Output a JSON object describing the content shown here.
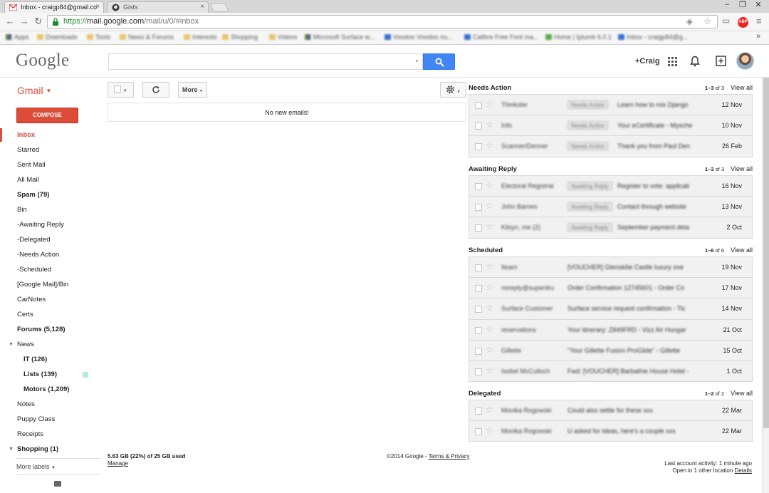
{
  "browser": {
    "tabs": [
      {
        "title": "Inbox - craigp84@gmail.co",
        "active": true,
        "icon": "gmail-icon"
      },
      {
        "title": "Gists",
        "active": false,
        "icon": "github-icon"
      }
    ],
    "url": {
      "scheme": "https://",
      "host": "mail.google.com",
      "path": "/mail/u/0/#inbox"
    },
    "abp_label": "ABP",
    "bookmarks": [
      "Apps",
      "Downloads",
      "Tools",
      "News & Forums",
      "Interests",
      "Shopping",
      "Videos",
      "Microsoft Surface w...",
      "Voodoo Voodoo nu...",
      "Calibre Free Font ma...",
      "Home | Iplumb 6.0.1",
      "Inbox - craigp84@g..."
    ],
    "more": "»"
  },
  "header": {
    "logo": "Google",
    "search_placeholder": "",
    "user_name": "+Craig"
  },
  "toolbar": {
    "app_label": "Gmail",
    "more_label": "More"
  },
  "sidebar": {
    "compose_label": "COMPOSE",
    "items": [
      {
        "label": "Inbox",
        "style": "active"
      },
      {
        "label": "Starred",
        "style": ""
      },
      {
        "label": "Sent Mail",
        "style": ""
      },
      {
        "label": "All Mail",
        "style": ""
      },
      {
        "label": "Spam (79)",
        "style": "bold"
      },
      {
        "label": "Bin",
        "style": ""
      },
      {
        "label": "-Awaiting Reply",
        "style": ""
      },
      {
        "label": "-Delegated",
        "style": ""
      },
      {
        "label": "-Needs Action",
        "style": ""
      },
      {
        "label": "-Scheduled",
        "style": ""
      },
      {
        "label": "[Google Mail]/Bin",
        "style": ""
      },
      {
        "label": "CarNotes",
        "style": ""
      },
      {
        "label": "Certs",
        "style": ""
      },
      {
        "label": "Forums (5,128)",
        "style": "bold"
      },
      {
        "label": "News",
        "style": "expand"
      },
      {
        "label": "IT (126)",
        "style": "bold sub"
      },
      {
        "label": "Lists (139)",
        "style": "bold sub swatch"
      },
      {
        "label": "Motors (1,209)",
        "style": "bold sub"
      },
      {
        "label": "Notes",
        "style": ""
      },
      {
        "label": "Puppy Class",
        "style": ""
      },
      {
        "label": "Receipts",
        "style": ""
      },
      {
        "label": "Shopping (1)",
        "style": "bold expand"
      }
    ],
    "more_labels": "More labels",
    "label_swatch_color": "#b3efd3"
  },
  "main": {
    "empty_message": "No new emails!"
  },
  "sections": [
    {
      "title": "Needs Action",
      "range_start": "1–3",
      "range_total": "of 3",
      "view_all": "View all",
      "rows": [
        {
          "sender": "Thinkster",
          "label": "Needs Action",
          "subject": "Learn how to mix Django",
          "date": "12 Nov"
        },
        {
          "sender": "Info",
          "label": "Needs Action",
          "subject": "Your eCertificate - Mysche",
          "date": "10 Nov"
        },
        {
          "sender": "Scanner/Denner",
          "label": "Needs Action",
          "subject": "Thank you from Paul Den",
          "date": "26 Feb"
        }
      ]
    },
    {
      "title": "Awaiting Reply",
      "range_start": "1–3",
      "range_total": "of 3",
      "view_all": "View all",
      "rows": [
        {
          "sender": "Electoral Registrat",
          "label": "Awaiting Reply",
          "subject": "Register to vote: applicati",
          "date": "16 Nov"
        },
        {
          "sender": "John Barnes",
          "label": "Awaiting Reply",
          "subject": "Contact through website",
          "date": "13 Nov"
        },
        {
          "sender": "Kilsyn, me (2)",
          "label": "Awaiting Reply",
          "subject": "September payment deta",
          "date": "2 Oct"
        }
      ]
    },
    {
      "title": "Scheduled",
      "range_start": "1–6",
      "range_total": "of 6",
      "view_all": "View all",
      "rows": [
        {
          "sender": "Iteam",
          "label": "",
          "subject": "[VOUCHER] Glenskilie Castle luxury ove",
          "date": "19 Nov"
        },
        {
          "sender": "noreply@superdru",
          "label": "",
          "subject": "Order Confirmation 12745601 - Order Co",
          "date": "17 Nov"
        },
        {
          "sender": "Surface Customer",
          "label": "",
          "subject": "Surface service request confirmation - Tic",
          "date": "14 Nov"
        },
        {
          "sender": "reservations",
          "label": "",
          "subject": "Your itinerary: Z849FRD - Vizz Air Hungar",
          "date": "21 Oct"
        },
        {
          "sender": "Gillette",
          "label": "",
          "subject": "\"Your Gillette Fusion ProGlide\" - Gillette",
          "date": "15 Oct"
        },
        {
          "sender": "Isobel McCulloch",
          "label": "",
          "subject": "Fwd: [VOUCHER] Barbathie House Hotel -",
          "date": "1 Oct"
        }
      ]
    },
    {
      "title": "Delegated",
      "range_start": "1–2",
      "range_total": "of 2",
      "view_all": "View all",
      "rows": [
        {
          "sender": "Monika Rogowski",
          "label": "",
          "subject": "Could also settle for these xxx",
          "date": "22 Mar"
        },
        {
          "sender": "Monika Rogowski",
          "label": "",
          "subject": "U asked for ideas, here's a couple xxx",
          "date": "22 Mar"
        }
      ]
    }
  ],
  "footer": {
    "usage": "5.63 GB (22%) of 25 GB used",
    "manage": "Manage",
    "copyright": "©2014 Google -",
    "terms": "Terms & Privacy",
    "last_activity": "Last account activity: 1 minute ago",
    "open_in": "Open in 1 other location",
    "details": "Details"
  },
  "colors": {
    "accent": "#dd4b39",
    "search_blue": "#4285f4"
  }
}
